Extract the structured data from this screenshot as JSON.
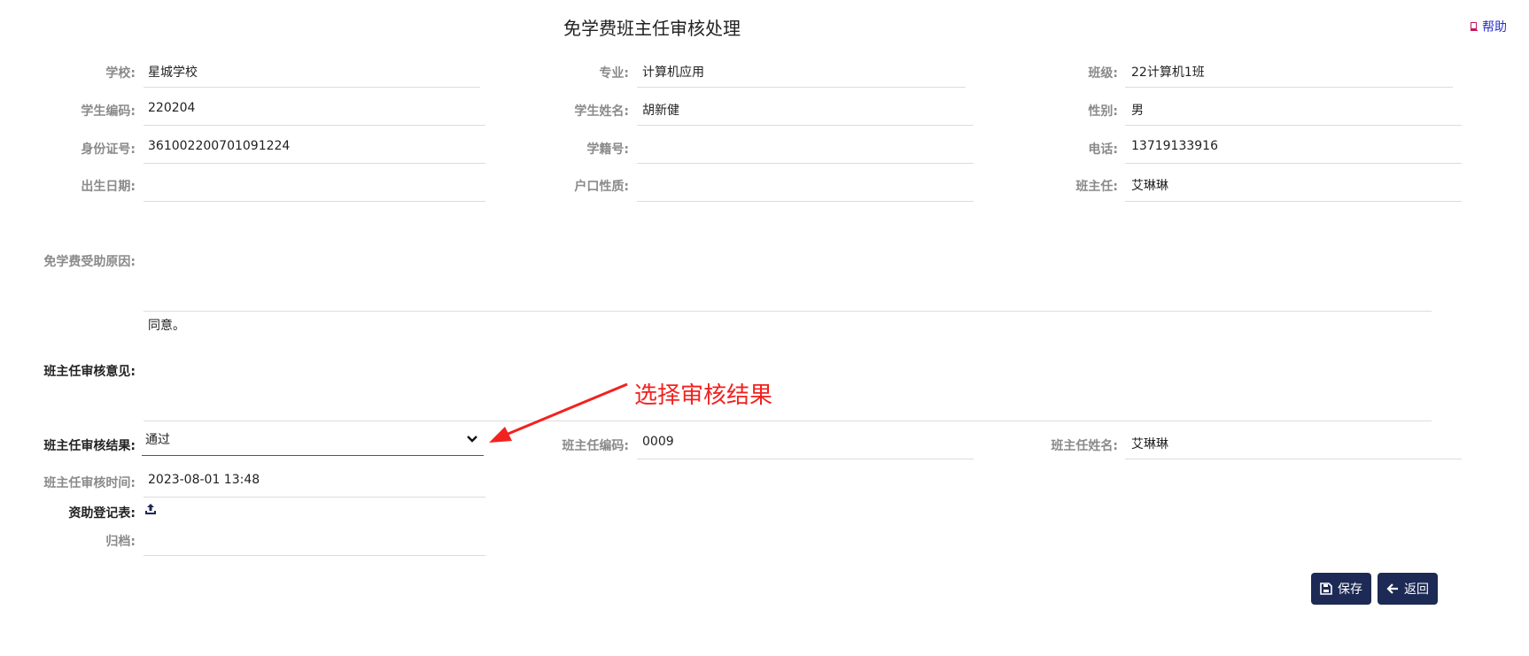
{
  "page": {
    "title": "免学费班主任审核处理",
    "help_label": "帮助"
  },
  "fields": {
    "school": {
      "label": "学校:",
      "value": "星城学校"
    },
    "major": {
      "label": "专业:",
      "value": "计算机应用"
    },
    "class": {
      "label": "班级:",
      "value": "22计算机1班"
    },
    "student_code": {
      "label": "学生编码:",
      "value": "220204"
    },
    "student_name": {
      "label": "学生姓名:",
      "value": "胡新健"
    },
    "gender": {
      "label": "性别:",
      "value": "男"
    },
    "id_number": {
      "label": "身份证号:",
      "value": "361002200701091224"
    },
    "enrollment_no": {
      "label": "学籍号:",
      "value": ""
    },
    "phone": {
      "label": "电话:",
      "value": "13719133916"
    },
    "birth_date": {
      "label": "出生日期:",
      "value": ""
    },
    "household_type": {
      "label": "户口性质:",
      "value": ""
    },
    "head_teacher": {
      "label": "班主任:",
      "value": "艾琳琳"
    },
    "aid_reason": {
      "label": "免学费受助原因:",
      "value": ""
    },
    "teacher_opinion": {
      "label": "班主任审核意见:",
      "value": "同意。"
    },
    "review_result": {
      "label": "班主任审核结果:",
      "value": "通过"
    },
    "teacher_code": {
      "label": "班主任编码:",
      "value": "0009"
    },
    "teacher_name": {
      "label": "班主任姓名:",
      "value": "艾琳琳"
    },
    "review_time": {
      "label": "班主任审核时间:",
      "value": "2023-08-01 13:48"
    },
    "aid_form": {
      "label": "资助登记表:",
      "icon": "upload-icon"
    },
    "archive": {
      "label": "归档:",
      "value": ""
    }
  },
  "annotation": {
    "text": "选择审核结果",
    "color": "#f2221f"
  },
  "buttons": {
    "save": "保存",
    "back": "返回"
  },
  "colors": {
    "accent": "#1c2a55",
    "help_link": "#2a2fc9"
  }
}
